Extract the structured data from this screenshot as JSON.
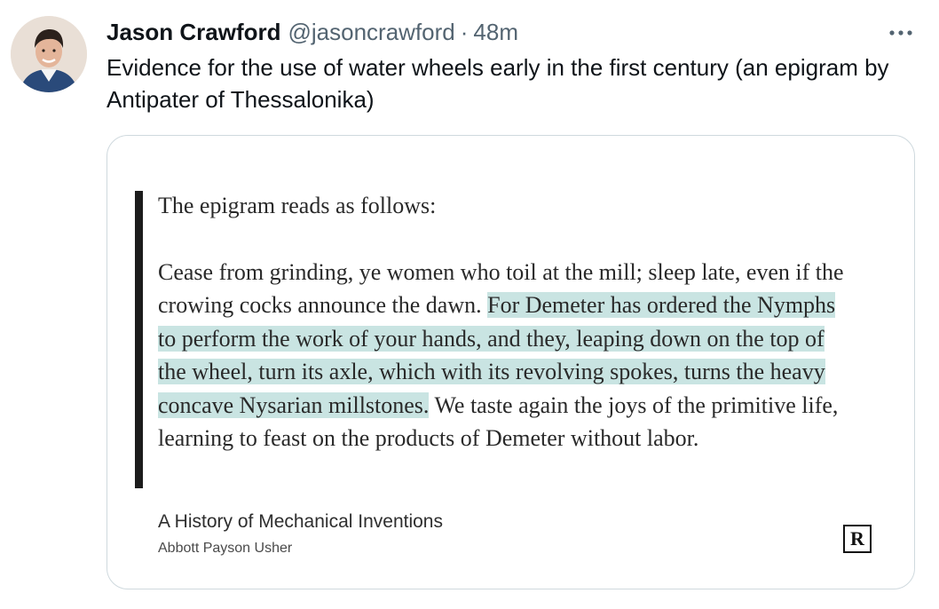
{
  "tweet": {
    "author": {
      "name": "Jason Crawford",
      "handle": "@jasoncrawford",
      "separator": "·",
      "time": "48m"
    },
    "text": "Evidence for the use of water wheels early in the first century (an epigram by Antipater of Thessalonika)",
    "icons": {
      "avatar": "avatar-photo",
      "more": "more-options-icon"
    }
  },
  "card": {
    "intro": "The epigram reads as follows:",
    "quote": {
      "before": "Cease from grinding, ye women who toil at the mill; sleep late, even if the crowing cocks announce the dawn. ",
      "highlight": "For Demeter has ordered the Nymphs to perform the work of your hands, and they, leaping down on the top of the wheel, turn its axle, which with its revolving spokes, turns the heavy concave Nysarian millstones.",
      "after": " We taste again the joys of the primitive life, learning to feast on the products of Demeter without labor."
    },
    "book_title": "A History of Mechanical Inventions",
    "book_author": "Abbott Payson Usher",
    "logo_letter": "R",
    "highlight_color": "#c9e4e2"
  }
}
